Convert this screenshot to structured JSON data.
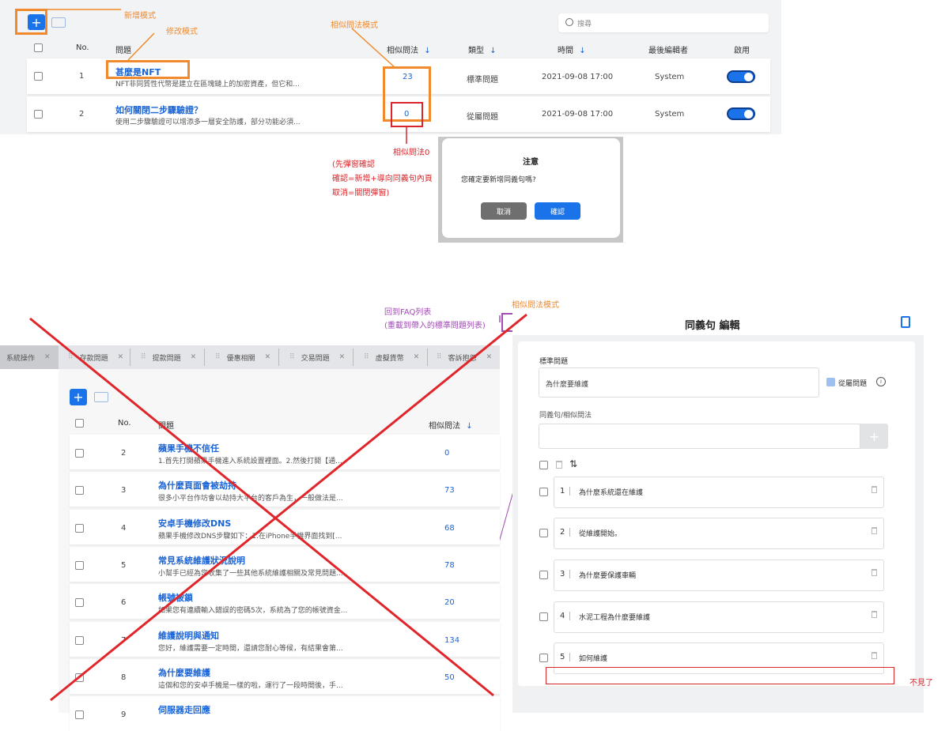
{
  "top": {
    "search_placeholder": "搜尋",
    "headers": {
      "no": "No.",
      "question": "問題",
      "similar": "相似問法",
      "type": "類型",
      "time": "時間",
      "editor": "最後編輯者",
      "enable": "啟用"
    },
    "sort_arrow": "↓",
    "add_icon": "+",
    "rows": [
      {
        "no": "1",
        "title": "甚麼是NFT",
        "desc": "NFT非同質性代幣是建立在區塊鏈上的加密資產，但它和...",
        "similar": "23",
        "type": "標準問題",
        "time": "2021-09-08 17:00",
        "editor": "System",
        "enabled": true
      },
      {
        "no": "2",
        "title": "如何關閉二步驟驗證？",
        "desc": "使用二步驟驗證可以增添多一層安全防護，部分功能必須...",
        "similar": "0",
        "type": "從屬問題",
        "time": "2021-09-08 17:00",
        "editor": "System",
        "enabled": true
      }
    ]
  },
  "annotations": {
    "add_mode": "新增模式",
    "edit_mode": "修改模式",
    "similar_mode": "相似問法模式",
    "similar_zero": "相似問法0",
    "popup_note_1": "(先彈窗確認",
    "popup_note_2": "確認=新增+導向同義句內頁",
    "popup_note_3": "取消=關閉彈窗)",
    "back_to_faq_1": "回到FAQ列表",
    "back_to_faq_2": "(重載到帶入的標準問題列表)",
    "similar_mode_2": "相似問法模式",
    "missing": "不見了"
  },
  "dialog": {
    "title": "注意",
    "message": "您確定要新增同義句嗎?",
    "cancel": "取消",
    "confirm": "確認"
  },
  "tabs": [
    {
      "label": "系統操作"
    },
    {
      "label": "存款問題"
    },
    {
      "label": "提款問題"
    },
    {
      "label": "優惠相關"
    },
    {
      "label": "交易問題"
    },
    {
      "label": "虛擬貨幣"
    },
    {
      "label": "客訴抱怨"
    }
  ],
  "bottom": {
    "headers": {
      "no": "No.",
      "question": "問題",
      "similar": "相似問法"
    },
    "sort_arrow": "↓",
    "add_icon": "+",
    "rows": [
      {
        "no": "2",
        "title": "蘋果手機不信任",
        "desc": "1.首先打開蘋果手機進入系統設置裡面。2.然後打開【通...",
        "similar": "0"
      },
      {
        "no": "3",
        "title": "為什麼頁面會被劫持",
        "desc": "很多小平台作坊會以劫持大平台的客戶為生，一般做法是...",
        "similar": "73"
      },
      {
        "no": "4",
        "title": "安卓手機修改DNS",
        "desc": "蘋果手機修改DNS步驟如下：1.在iPhone手機界面找到[...",
        "similar": "68"
      },
      {
        "no": "5",
        "title": "常見系統維護狀況說明",
        "desc": "小幫手已經為您收集了一些其他系統維護相關及常見問題...",
        "similar": "78"
      },
      {
        "no": "6",
        "title": "帳號被鎖",
        "desc": "如果您有連續輸入錯誤的密碼5次，系統為了您的帳號資金...",
        "similar": "20"
      },
      {
        "no": "7",
        "title": "維護說明與通知",
        "desc": "您好，維護需要一定時間，還請您耐心等候，有結果會第...",
        "similar": "134"
      },
      {
        "no": "8",
        "title": "為什麼要維護",
        "desc": "這個和您的安卓手機是一樣的啦，運行了一段時間後，手...",
        "similar": "50"
      },
      {
        "no": "9",
        "title": "伺服器走回應",
        "desc": "",
        "similar": ""
      }
    ]
  },
  "editor": {
    "title": "同義句 編輯",
    "std_label": "標準問題",
    "std_value": "為什麼要維護",
    "sub_label": "從屬問題",
    "syn_label": "同義句/相似問法",
    "add_icon": "+",
    "sort_icon": "⇅",
    "items": [
      {
        "n": "1",
        "text": "為什麼系統還在維護"
      },
      {
        "n": "2",
        "text": "從維護開始。"
      },
      {
        "n": "3",
        "text": "為什麼要保護車輛"
      },
      {
        "n": "4",
        "text": "水泥工程為什麼要維護"
      },
      {
        "n": "5",
        "text": "如何維護"
      }
    ]
  },
  "colors": {
    "accent": "#1a73e8",
    "annotation_orange": "#f08a2c",
    "annotation_red": "#d9262b",
    "annotation_purple": "#a24bb5",
    "cross_red": "#e0262b"
  }
}
